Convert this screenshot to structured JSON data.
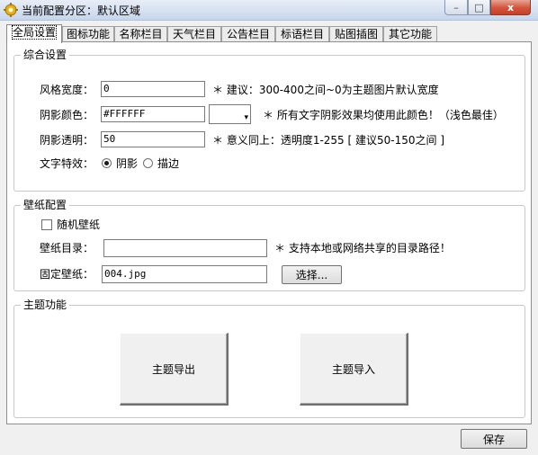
{
  "window": {
    "title": "当前配置分区：默认区域",
    "controls": {
      "minimize": "–",
      "maximize": "□",
      "close": "x"
    }
  },
  "tabs": [
    {
      "label": "全局设置",
      "active": true
    },
    {
      "label": "图标功能"
    },
    {
      "label": "名称栏目"
    },
    {
      "label": "天气栏目"
    },
    {
      "label": "公告栏目"
    },
    {
      "label": "标语栏目"
    },
    {
      "label": "贴图插图"
    },
    {
      "label": "其它功能"
    }
  ],
  "general": {
    "title": "综合设置",
    "style_width": {
      "label": "风格宽度：",
      "value": "0",
      "hint": "＊ 建议：300-400之间~0为主题图片默认宽度"
    },
    "shadow_color": {
      "label": "阴影颜色：",
      "value": "#FFFFFF",
      "swatch": "#FFFFFF",
      "hint": "＊ 所有文字阴影效果均使用此颜色！（浅色最佳）"
    },
    "shadow_alpha": {
      "label": "阴影透明：",
      "value": "50",
      "hint": "＊ 意义同上：透明度1-255 [ 建议50-150之间 ]"
    },
    "text_effect": {
      "label": "文字特效：",
      "options": [
        {
          "label": "阴影",
          "selected": true
        },
        {
          "label": "描边",
          "selected": false
        }
      ]
    }
  },
  "wallpaper": {
    "title": "壁纸配置",
    "random": {
      "label": "随机壁纸",
      "checked": false
    },
    "directory": {
      "label": "壁纸目录：",
      "value": "",
      "hint": "＊ 支持本地或网络共享的目录路径！"
    },
    "fixed": {
      "label": "固定壁纸：",
      "value": "004.jpg",
      "button": "选择..."
    }
  },
  "theme": {
    "title": "主题功能",
    "export_button": "主题导出",
    "import_button": "主题导入"
  },
  "footer": {
    "save_button": "保存"
  }
}
